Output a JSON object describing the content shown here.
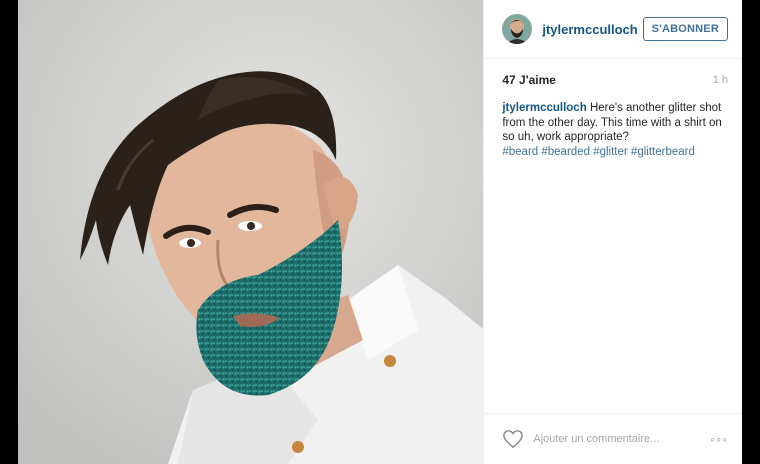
{
  "post": {
    "username": "jtylermcculloch",
    "follow_label": "S'ABONNER",
    "likes": "47 J'aime",
    "time_ago": "1 h",
    "caption_user": "jtylermcculloch",
    "caption_text": "Here's another glitter shot from the other day. This time with a shirt on so uh, work appropriate?",
    "hashtags": [
      "#beard",
      "#bearded",
      "#glitter",
      "#glitterbeard"
    ],
    "comment_placeholder": "Ajouter un commentaire...",
    "more_icon": "ellipsis-icon",
    "like_icon": "heart-icon"
  },
  "colors": {
    "link": "#125688",
    "hashtag": "#3f729b",
    "glitter_beard": "#1f7f7a"
  }
}
